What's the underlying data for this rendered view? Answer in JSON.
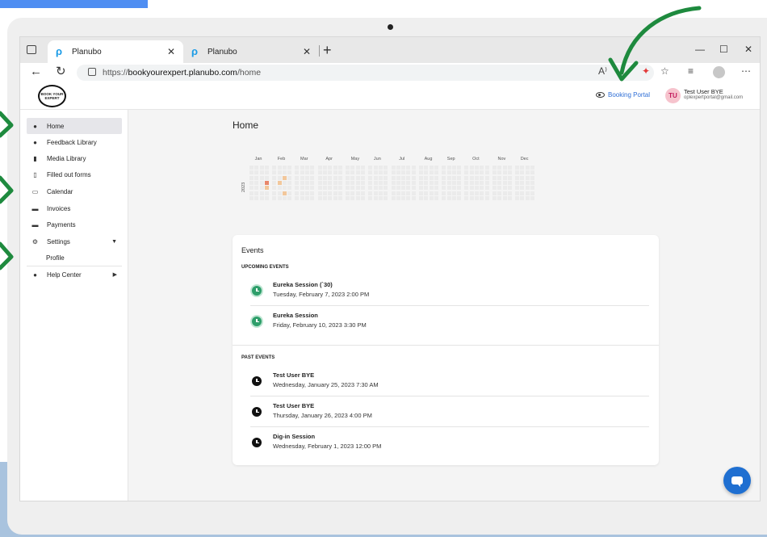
{
  "browser": {
    "tabs": [
      {
        "title": "Planubo",
        "active": true
      },
      {
        "title": "Planubo",
        "active": false
      }
    ],
    "url_scheme": "https://",
    "url_host": "bookyourexpert.planubo.com",
    "url_path": "/home",
    "new_tab_glyph": "+",
    "close_glyph": "✕",
    "window_controls": [
      "—",
      "☐",
      "✕"
    ],
    "toolbar_icons": [
      "read-aloud-icon",
      "extension-icon",
      "favorites-add-icon",
      "collections-icon",
      "profile-icon",
      "more-icon"
    ],
    "toolbar_glyphs": [
      "A⁾",
      "✦",
      "☆",
      "≡",
      "⋯"
    ]
  },
  "header": {
    "logo_text": "BOOK YOUR EXPERT",
    "booking_portal": "Booking Portal",
    "user_initials": "TU",
    "user_name": "Test User BYE",
    "user_email": "oplexpertportal@gmail.com"
  },
  "sidebar": {
    "items": [
      {
        "label": "Home",
        "icon": "account-circle-icon",
        "glyph": "●"
      },
      {
        "label": "Feedback Library",
        "icon": "chat-bubble-icon",
        "glyph": "●"
      },
      {
        "label": "Media Library",
        "icon": "bank-icon",
        "glyph": "▮"
      },
      {
        "label": "Filled out forms",
        "icon": "copy-icon",
        "glyph": "▯"
      },
      {
        "label": "Calendar",
        "icon": "calendar-icon",
        "glyph": "▭"
      },
      {
        "label": "Invoices",
        "icon": "invoice-icon",
        "glyph": "▬"
      },
      {
        "label": "Payments",
        "icon": "card-icon",
        "glyph": "▬"
      },
      {
        "label": "Settings",
        "icon": "gear-icon",
        "glyph": "⚙",
        "caret": "▼"
      },
      {
        "label": "Profile"
      },
      {
        "label": "Help Center",
        "icon": "info-icon",
        "glyph": "●",
        "caret": "▶"
      }
    ]
  },
  "main": {
    "title": "Home",
    "heatmap": {
      "year": "2023",
      "months": [
        "Jan",
        "Feb",
        "Mar",
        "Apr",
        "May",
        "Jun",
        "Jul",
        "Aug",
        "Sep",
        "Oct",
        "Nov",
        "Dec"
      ],
      "empty_color": "#ebebeb",
      "low_color": "#f2c79b",
      "high_color": "#e8866a",
      "active_cells": [
        {
          "week": 3,
          "day": 3,
          "level": 2
        },
        {
          "week": 3,
          "day": 4,
          "level": 1
        },
        {
          "week": 5,
          "day": 3,
          "level": 1
        },
        {
          "week": 6,
          "day": 2,
          "level": 1
        },
        {
          "week": 6,
          "day": 5,
          "level": 1
        }
      ]
    },
    "events": {
      "title": "Events",
      "upcoming_label": "UPCOMING EVENTS",
      "past_label": "PAST EVENTS",
      "upcoming": [
        {
          "name": "Eureka Session (`30)",
          "date": "Tuesday, February 7, 2023 2:00 PM"
        },
        {
          "name": "Eureka Session",
          "date": "Friday, February 10, 2023 3:30 PM"
        }
      ],
      "past": [
        {
          "name": "Test User BYE",
          "date": "Wednesday, January 25, 2023 7:30 AM"
        },
        {
          "name": "Test User BYE",
          "date": "Thursday, January 26, 2023 4:00 PM"
        },
        {
          "name": "Dig-in Session",
          "date": "Wednesday, February 1, 2023 12:00 PM"
        }
      ]
    }
  },
  "colors": {
    "accent": "#2f6fd6",
    "upcoming_icon": "#2e9e6a",
    "arrow": "#1e8a3e",
    "chat": "#1f6fd1"
  }
}
